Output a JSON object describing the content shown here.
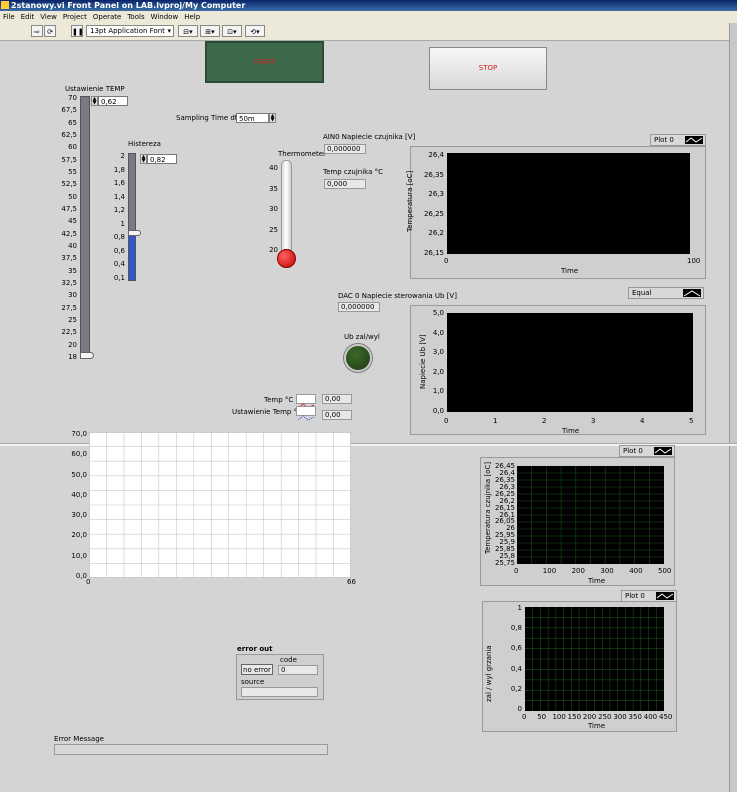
{
  "window": {
    "title": "2stanowy.vi Front Panel on LAB.lvproj/My Computer"
  },
  "menu": [
    "File",
    "Edit",
    "View",
    "Project",
    "Operate",
    "Tools",
    "Window",
    "Help"
  ],
  "toolbar": {
    "font": "13pt Application Font"
  },
  "controls": {
    "start_label": "START",
    "stop_label": "STOP",
    "sampling_label": "Sampling Time dt (s)",
    "sampling_value": "50m"
  },
  "temp_setpoint": {
    "label": "Ustawienie TEMP",
    "value": "0,62",
    "value_fraction": 0.0,
    "ticks": [
      "70",
      "67,5",
      "65",
      "62,5",
      "60",
      "57,5",
      "55",
      "52,5",
      "50",
      "47,5",
      "45",
      "42,5",
      "40",
      "37,5",
      "35",
      "32,5",
      "30",
      "27,5",
      "25",
      "22,5",
      "20",
      "18"
    ]
  },
  "hysteresis": {
    "label": "Histereza",
    "value": "0,82",
    "value_fraction": 0.38,
    "ticks": [
      "2",
      "1,8",
      "1,6",
      "1,4",
      "1,2",
      "1",
      "0,8",
      "0,6",
      "0,4",
      "0,1"
    ]
  },
  "thermometer": {
    "label": "Thermometer",
    "ticks": [
      "40",
      "35",
      "30",
      "25",
      "20"
    ]
  },
  "indicators": {
    "ain0_label": "AIN0 Napiecie czujnika [V]",
    "ain0_value": "0,000000",
    "temp_label": "Temp czujnika °C",
    "temp_value": "0,000",
    "dac_label": "DAC 0 Napiecie sterowania Ub [V]",
    "dac_value": "0,000000",
    "ub_label": "Ub zal/wyl",
    "legend_temp": "Temp °C",
    "legend_temp_val": "0,00",
    "legend_set": "Ustawienie Temp °C",
    "legend_set_val": "0,00"
  },
  "chart_temp": {
    "legend": "Plot 0",
    "ylabel": "Temperatura [oC]",
    "xlabel": "Time",
    "yticks": [
      "26,4",
      "26,35",
      "26,3",
      "26,25",
      "26,2",
      "26,15"
    ],
    "xticks": [
      "0",
      "100"
    ]
  },
  "chart_ub": {
    "legend": "Equal",
    "ylabel": "Napiecie Ub [V]",
    "xlabel": "Time",
    "yticks": [
      "5,0",
      "4,0",
      "3,0",
      "2,0",
      "1,0",
      "0,0"
    ],
    "xticks": [
      "0",
      "1",
      "2",
      "3",
      "4",
      "5"
    ]
  },
  "chart_white": {
    "yticks": [
      "70,0",
      "60,0",
      "50,0",
      "40,0",
      "30,0",
      "20,0",
      "10,0",
      "0,0"
    ],
    "xticks": [
      "0",
      "66"
    ]
  },
  "chart_sensor": {
    "legend": "Plot 0",
    "ylabel": "Temperatura czujnika [oC]",
    "xlabel": "Time",
    "yticks": [
      "26,45",
      "26,4",
      "26,35",
      "26,3",
      "26,25",
      "26,2",
      "26,15",
      "26,1",
      "26,05",
      "26",
      "25,95",
      "25,9",
      "25,85",
      "25,8",
      "25,75"
    ],
    "xticks": [
      "0",
      "100",
      "200",
      "300",
      "400",
      "500"
    ]
  },
  "chart_heat": {
    "legend": "Plot 0",
    "ylabel": "zal / wyl grzania",
    "xlabel": "Time",
    "yticks": [
      "1",
      "0,8",
      "0,6",
      "0,4",
      "0,2",
      "0"
    ],
    "xticks": [
      "0",
      "50",
      "100",
      "150",
      "200",
      "250",
      "300",
      "350",
      "400",
      "450"
    ]
  },
  "error_out": {
    "title": "error out",
    "status": "no error",
    "code_label": "code",
    "code_value": "0",
    "source_label": "source"
  },
  "error_message": {
    "label": "Error Message"
  },
  "colors": {
    "start_bg": "#3e6a4c",
    "stop_text": "#d02020",
    "led": "#1e3a14",
    "grid_green": "#1b4d1b"
  }
}
